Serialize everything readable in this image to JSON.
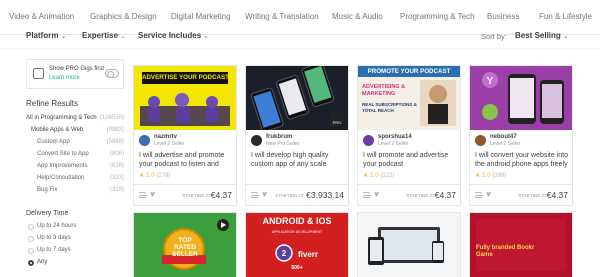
{
  "category_nav": [
    "Video & Animation",
    "Graphics & Design",
    "Digital Marketing",
    "Writing & Translation",
    "Music & Audio",
    "Programming & Tech",
    "Business",
    "Fun & Lifestyle"
  ],
  "filters": {
    "platform": "Platform",
    "expertise": "Expertise",
    "service_includes": "Service Includes",
    "sort_label": "Sort by:",
    "sort_value": "Best Selling"
  },
  "pro_toggle": {
    "label": "Show PRO Gigs first",
    "learn_more": "Learn more"
  },
  "refine": {
    "heading": "Refine Results",
    "all": {
      "label": "All in Programming & Tech",
      "count": "(106530)"
    },
    "sub": {
      "label": "Mobile Apps & Web",
      "count": "(9983)"
    },
    "items": [
      {
        "label": "Custom App",
        "count": "(5869)"
      },
      {
        "label": "Convert Site to App",
        "count": "(806)"
      },
      {
        "label": "App Improvements",
        "count": "(826)"
      },
      {
        "label": "Help/Consultation",
        "count": "(323)"
      },
      {
        "label": "Bug Fix",
        "count": "(319)"
      }
    ]
  },
  "delivery": {
    "heading": "Delivery Time",
    "options": [
      "Up to 24 hours",
      "Up to 3 days",
      "Up to 7 days",
      "Any"
    ],
    "selected": "Any"
  },
  "cards": [
    {
      "thumb_text": "ADVERTISE YOUR PODCAST",
      "seller": "nazmrtv",
      "level": "Level 2 Seller",
      "title": "I will advertise and promote your podcast to listen and",
      "rating": "5.0",
      "reviews": "(278)",
      "starting": "STARTING AT",
      "price": "€4.37",
      "avatar_color": "#3b6bb5"
    },
    {
      "thumb_text": "",
      "seller": "frukbrum",
      "level": "New Pro Seller",
      "title": "I will develop high quality custom app of any scale",
      "rating": "",
      "reviews": "",
      "starting": "STARTING AT",
      "price": "€3.933.14",
      "pro_badge": "PRO",
      "avatar_color": "#2a2a2a"
    },
    {
      "thumb_text": "PROMOTE YOUR PODCAST",
      "thumb_sub": "ADVERTISING & MARKETING",
      "thumb_sub2": "REAL SUBSCRIPTIONS & TOTAL REACH",
      "seller": "sporshua14",
      "level": "Level 2 Seller",
      "title": "I will promote and advertise your podcast",
      "rating": "5.0",
      "reviews": "(122)",
      "starting": "STARTING AT",
      "price": "€4.37",
      "avatar_color": "#6b3fa0"
    },
    {
      "thumb_text": "",
      "seller": "nebout47",
      "level": "Level 2 Seller",
      "title": "I will convert your website into the android phone apps freely",
      "rating": "5.0",
      "reviews": "(398)",
      "starting": "STARTING AT",
      "price": "€4.37",
      "avatar_color": "#8a5a2e"
    }
  ],
  "row2": [
    {
      "thumb_text": "TOP RATED SELLER"
    },
    {
      "thumb_text": "ANDROID & IOS",
      "thumb_sub": "APPLICATION DEVELOPMENT",
      "thumb_brand": "fiverr",
      "thumb_num": "2",
      "thumb_foot": "500+"
    },
    {
      "thumb_text": ""
    },
    {
      "thumb_text": "Fully branded Bookr Game"
    }
  ],
  "colors": {
    "accent": "#1dbf73",
    "star": "#ffb33e",
    "text": "#404145",
    "muted": "#74767e"
  }
}
